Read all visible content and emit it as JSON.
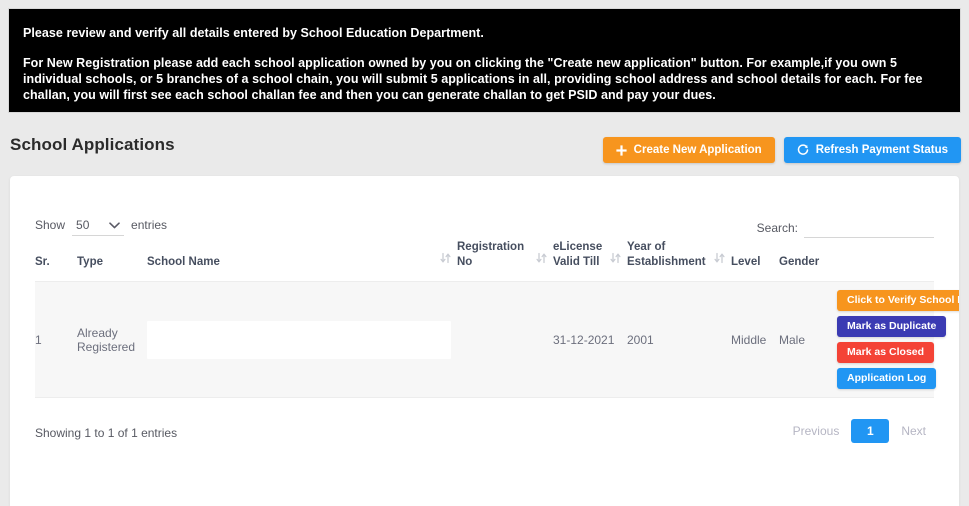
{
  "notice": {
    "line1": "Please review and verify all details entered by School Education Department.",
    "line2": "For New Registration please add each school application owned by you on clicking the \"Create new application\" button. For example,if you own 5 individual schools, or 5 branches of a school chain, you will submit 5 applications in all, providing school address and school details for each. For fee challan, you will first see each school challan fee and then you can generate challan to get PSID and pay your dues."
  },
  "header": {
    "title": "School Applications",
    "create_button": "Create New Application",
    "refresh_button": "Refresh Payment Status"
  },
  "controls": {
    "show_label": "Show",
    "entries_label": "entries",
    "page_length": "50",
    "search_label": "Search:",
    "search_value": "",
    "search_placeholder": ""
  },
  "table": {
    "columns": [
      {
        "label": "Sr.",
        "sortable": false
      },
      {
        "label": "Type",
        "sortable": false
      },
      {
        "label": "School Name",
        "sortable": true
      },
      {
        "label": "Registration No",
        "sortable": true
      },
      {
        "label": "eLicense Valid Till",
        "sortable": true
      },
      {
        "label": "Year of Establishment",
        "sortable": true
      },
      {
        "label": "Level",
        "sortable": false
      },
      {
        "label": "Gender",
        "sortable": false
      },
      {
        "label": "",
        "sortable": false
      }
    ],
    "rows": [
      {
        "sr": "1",
        "type": "Already Registered",
        "school_name": "",
        "registration_no": "",
        "elicense_valid_till": "31-12-2021",
        "year_of_establishment": "2001",
        "level": "Middle",
        "gender": "Male",
        "actions": [
          {
            "label": "Click to Verify School Profile",
            "style": "verify"
          },
          {
            "label": "Mark as Duplicate",
            "style": "duplicate"
          },
          {
            "label": "Mark as Closed",
            "style": "closed"
          },
          {
            "label": "Application Log",
            "style": "log"
          }
        ]
      }
    ]
  },
  "footer": {
    "info": "Showing 1 to 1 of 1 entries",
    "previous": "Previous",
    "page_1": "1",
    "next": "Next"
  },
  "colors": {
    "orange": "#f7951e",
    "blue": "#2196f3",
    "indigo": "#3b3bb3",
    "red": "#f44336",
    "banner_bg": "#000000"
  }
}
